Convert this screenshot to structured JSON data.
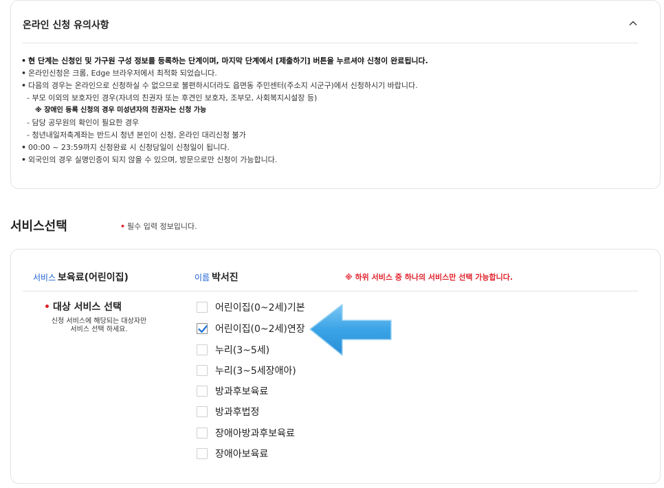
{
  "notice": {
    "title": "온라인 신청 유의사항",
    "lines": [
      "현 단계는 신청인 및 가구원 구성 정보를 등록하는 단계이며, 마지막 단계에서 [제출하기] 버튼을 누르셔야 신청이 완료됩니다.",
      "온라인신청은 크롬, Edge 브라우저에서 최적화 되었습니다.",
      "다음의 경우는 온라인으로 신청하실 수 없으므로 불편하시더라도 읍면동 주민센터(주소지 시군구)에서 신청하시기 바랍니다.",
      "- 부모 이외의 보호자인 경우(자녀의 친권자 또는 후견인 보호자, 조부모, 사회복지시설장 등)",
      "※ 장애인 등록 신청의 경우 미성년자의 친권자는 신청 가능",
      "- 담당 공무원의 확인이 필요한 경우",
      "- 청년내일저축계좌는 반드시 청년 본인이 신청, 온라인 대리신청 불가",
      "00:00 ~ 23:59까지 신청완료 시 신청당일이 신청일이 됩니다.",
      "외국인의 경우 실명인증이 되지 않을 수 있으며, 방문으로만 신청이 가능합니다."
    ],
    "bullet": "•"
  },
  "section": {
    "title": "서비스선택",
    "required_dot": "•",
    "required_note": "필수 입력 정보입니다."
  },
  "service": {
    "service_label": "서비스",
    "service_value": "보육료(어린이집)",
    "name_label": "이름",
    "name_value": "박서진",
    "warning": "※ 하위 서비스 중 하나의 서비스만 선택 가능합니다.",
    "target_dot": "•",
    "target_title": "대상 서비스 선택",
    "target_desc_1": "신청 서비스에 해당되는 대상자만",
    "target_desc_2": "서비스 선택 하세요.",
    "options": [
      {
        "label": "어린이집(0~2세)기본",
        "checked": false
      },
      {
        "label": "어린이집(0~2세)연장",
        "checked": true
      },
      {
        "label": "누리(3~5세)",
        "checked": false
      },
      {
        "label": "누리(3~5세장애아)",
        "checked": false
      },
      {
        "label": "방과후보육료",
        "checked": false
      },
      {
        "label": "방과후법정",
        "checked": false
      },
      {
        "label": "장애아방과후보육료",
        "checked": false
      },
      {
        "label": "장애아보육료",
        "checked": false
      }
    ]
  },
  "colors": {
    "accent_blue": "#1a5fd1",
    "required_red": "#e0212b",
    "arrow_blue": "#3aa3e6",
    "check_blue": "#1a6fd6"
  },
  "icons": {
    "collapse": "chevron-up-icon",
    "check": "check-icon",
    "pointer": "arrow-left-icon"
  }
}
